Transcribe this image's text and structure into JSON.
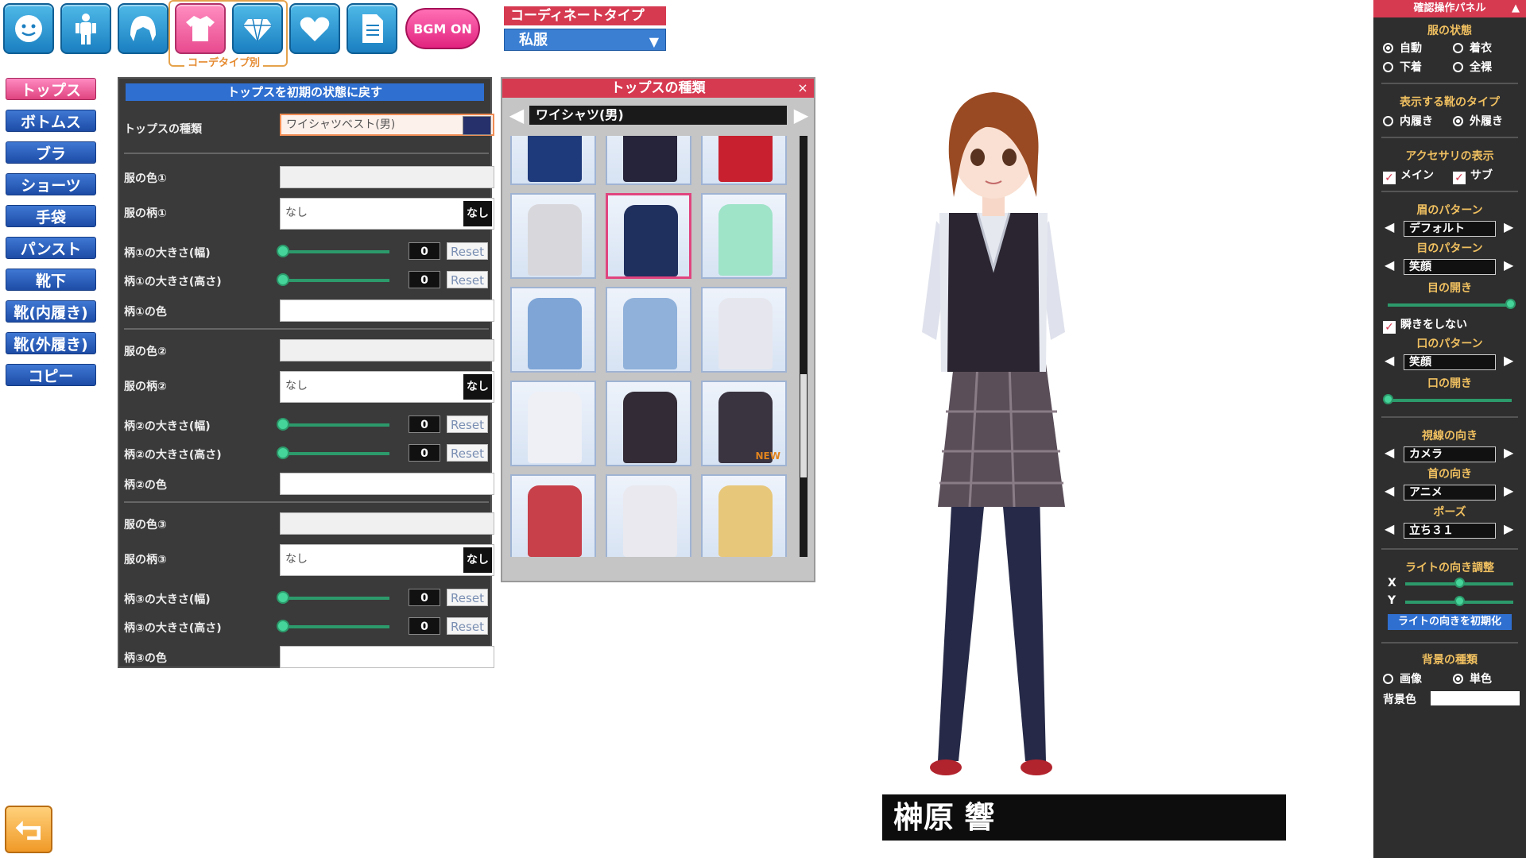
{
  "topbar": {
    "icons": [
      "face-icon",
      "body-icon",
      "hair-icon",
      "shirt-icon",
      "gem-icon",
      "heart-icon",
      "document-icon"
    ],
    "active_caption": "コーデタイプ別",
    "bgm_label": "BGM ON"
  },
  "coordinate": {
    "title": "コーディネートタイプ",
    "value": "私服"
  },
  "categories": [
    "トップス",
    "ボトムス",
    "ブラ",
    "ショーツ",
    "手袋",
    "パンスト",
    "靴下",
    "靴(内履き)",
    "靴(外履き)",
    "コピー"
  ],
  "settings": {
    "reset_all": "トップスを初期の状態に戻す",
    "type_label": "トップスの種類",
    "type_value": "ワイシャツベスト(男)",
    "color1": "服の色①",
    "pattern1": "服の柄①",
    "pattern_value": "なし",
    "none_btn": "なし",
    "p1w": "柄①の大きさ(幅)",
    "p1h": "柄①の大きさ(高さ)",
    "p1c": "柄①の色",
    "color2": "服の色②",
    "pattern2": "服の柄②",
    "p2w": "柄②の大きさ(幅)",
    "p2h": "柄②の大きさ(高さ)",
    "p2c": "柄②の色",
    "color3": "服の色③",
    "pattern3": "服の柄③",
    "p3w": "柄③の大きさ(幅)",
    "p3h": "柄③の大きさ(高さ)",
    "p3c": "柄③の色",
    "zero": "0",
    "reset": "Reset"
  },
  "picker": {
    "title": "トップスの種類",
    "close": "×",
    "category": "ワイシャツ(男)",
    "new_badge": "NEW"
  },
  "character": {
    "name": "榊原 響"
  },
  "right_panel": {
    "title": "確認操作パネル",
    "cloth_state": "服の状態",
    "auto": "自動",
    "dressed": "着衣",
    "underwear": "下着",
    "nude": "全裸",
    "shoe_type": "表示する靴のタイプ",
    "indoor": "内履き",
    "outdoor": "外履き",
    "accessory": "アクセサリの表示",
    "main": "メイン",
    "sub": "サブ",
    "brow_pattern": "眉のパターン",
    "brow_value": "デフォルト",
    "eye_pattern": "目のパターン",
    "eye_value": "笑顔",
    "eye_open": "目の開き",
    "no_blink": "瞬きをしない",
    "mouth_pattern": "口のパターン",
    "mouth_value": "笑顔",
    "mouth_open": "口の開き",
    "gaze": "視線の向き",
    "gaze_value": "カメラ",
    "neck": "首の向き",
    "neck_value": "アニメ",
    "pose": "ポーズ",
    "pose_value": "立ち３１",
    "light": "ライトの向き調整",
    "x": "X",
    "y": "Y",
    "light_reset": "ライトの向きを初期化",
    "bg_type": "背景の種類",
    "image": "画像",
    "solid": "単色",
    "bg_color": "背景色"
  }
}
